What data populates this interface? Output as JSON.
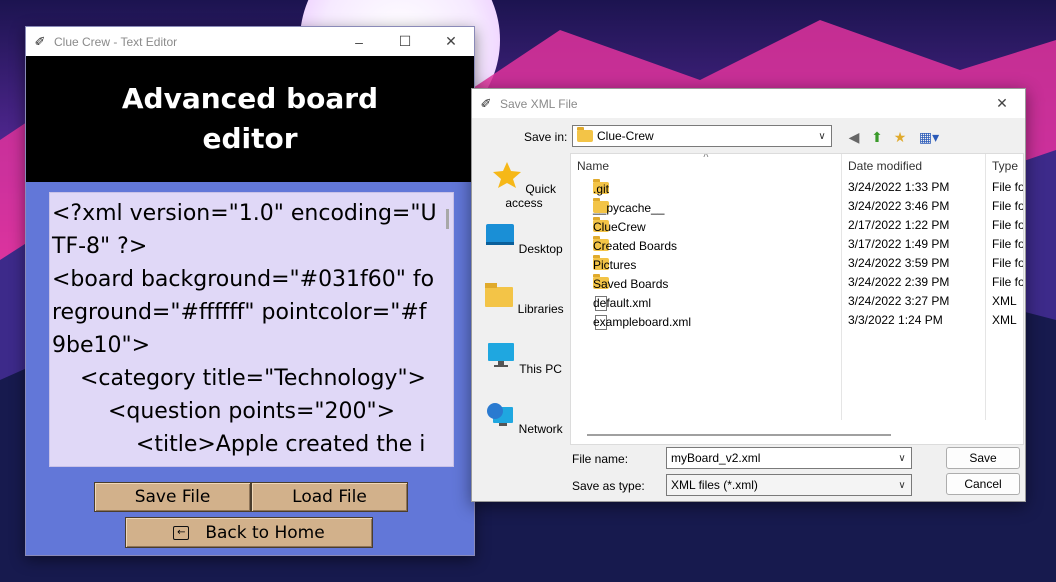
{
  "editor_window": {
    "title": "Clue Crew - Text Editor",
    "heading": "Advanced board editor",
    "content": "<?xml version=\"1.0\" encoding=\"UTF-8\" ?>\n<board background=\"#031f60\" foreground=\"#ffffff\" pointcolor=\"#f9be10\">\n    <category title=\"Technology\">\n        <question points=\"200\">\n            <title>Apple created the i",
    "save_label": "Save File",
    "load_label": "Load File",
    "back_label": "Back to Home"
  },
  "dialog": {
    "title": "Save XML File",
    "save_in_label": "Save in:",
    "save_in_value": "Clue-Crew",
    "places": [
      {
        "label": "Quick access",
        "icon": "star-icon"
      },
      {
        "label": "Desktop",
        "icon": "desktop-icon"
      },
      {
        "label": "Libraries",
        "icon": "libraries-icon"
      },
      {
        "label": "This PC",
        "icon": "this-pc-icon"
      },
      {
        "label": "Network",
        "icon": "network-icon"
      }
    ],
    "columns": {
      "name": "Name",
      "date": "Date modified",
      "type": "Type"
    },
    "files": [
      {
        "name": ".git",
        "date": "3/24/2022 1:33 PM",
        "type": "File fo",
        "kind": "folder"
      },
      {
        "name": "__pycache__",
        "date": "3/24/2022 3:46 PM",
        "type": "File fo",
        "kind": "folder"
      },
      {
        "name": "ClueCrew",
        "date": "2/17/2022 1:22 PM",
        "type": "File fo",
        "kind": "folder"
      },
      {
        "name": "Created Boards",
        "date": "3/17/2022 1:49 PM",
        "type": "File fo",
        "kind": "folder"
      },
      {
        "name": "Pictures",
        "date": "3/24/2022 3:59 PM",
        "type": "File fo",
        "kind": "folder"
      },
      {
        "name": "Saved Boards",
        "date": "3/24/2022 2:39 PM",
        "type": "File fo",
        "kind": "folder"
      },
      {
        "name": "default.xml",
        "date": "3/24/2022 3:27 PM",
        "type": "XML",
        "kind": "file"
      },
      {
        "name": "exampleboard.xml",
        "date": "3/3/2022 1:24 PM",
        "type": "XML",
        "kind": "file"
      }
    ],
    "filename_label": "File name:",
    "filename_value": "myBoard_v2.xml",
    "filetype_label": "Save as type:",
    "filetype_value": "XML files (*.xml)",
    "save_button": "Save",
    "cancel_button": "Cancel"
  },
  "colors": {
    "editor_bg": "#6277d8",
    "text_area_bg": "#e0d8f7",
    "button_tan": "#d2b18b",
    "folder_yellow": "#f3c447"
  }
}
